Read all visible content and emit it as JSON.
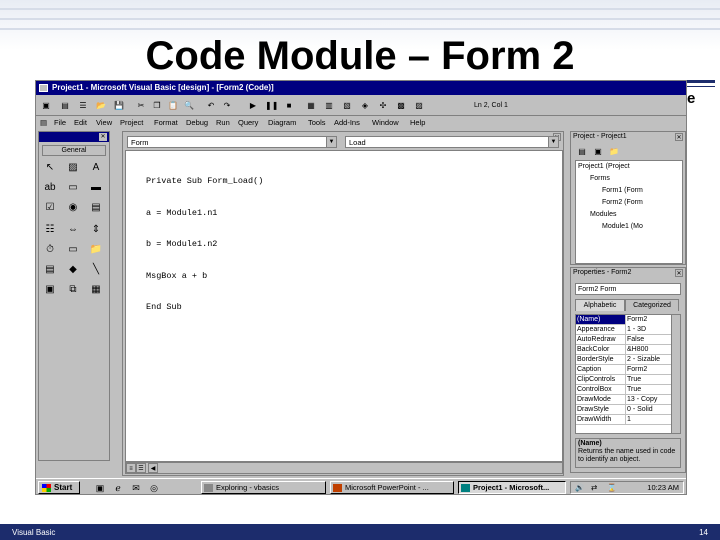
{
  "slide": {
    "title": "Code Module – Form 2",
    "cut_word": "ure",
    "footer_left": "Visual Basic",
    "page_number": "14"
  },
  "window": {
    "title": "Project1 - Microsoft Visual Basic [design] - [Form2 (Code)]",
    "toolbar_position": "Ln 2, Col 1"
  },
  "menu": [
    "File",
    "Edit",
    "View",
    "Project",
    "Format",
    "Debug",
    "Run",
    "Query",
    "Diagram",
    "Tools",
    "Add-Ins",
    "Window",
    "Help"
  ],
  "toolbox": {
    "tab_label": "General"
  },
  "code_window": {
    "object_combo": "Form",
    "procedure_combo": "Load",
    "lines": [
      "Private Sub Form_Load()",
      "a = Module1.n1",
      "b = Module1.n2",
      "MsgBox a + b",
      "End Sub"
    ]
  },
  "project_explorer": {
    "title": "Project - Project1",
    "items": [
      "Project1 (Project",
      "Forms",
      "Form1 (Form",
      "Form2 (Form",
      "Modules",
      "Module1 (Mo"
    ]
  },
  "properties": {
    "title": "Properties - Form2",
    "object_combo": "Form2 Form",
    "tabs": [
      "Alphabetic",
      "Categorized"
    ],
    "rows": [
      {
        "name": "(Name)",
        "value": "Form2"
      },
      {
        "name": "Appearance",
        "value": "1 - 3D"
      },
      {
        "name": "AutoRedraw",
        "value": "False"
      },
      {
        "name": "BackColor",
        "value": "&H800"
      },
      {
        "name": "BorderStyle",
        "value": "2 - Sizable"
      },
      {
        "name": "Caption",
        "value": "Form2"
      },
      {
        "name": "ClipControls",
        "value": "True"
      },
      {
        "name": "ControlBox",
        "value": "True"
      },
      {
        "name": "DrawMode",
        "value": "13 - Copy"
      },
      {
        "name": "DrawStyle",
        "value": "0 - Solid"
      },
      {
        "name": "DrawWidth",
        "value": "1"
      }
    ],
    "description_title": "(Name)",
    "description_text": "Returns the name used in code to identify an object."
  },
  "taskbar": {
    "start_label": "Start",
    "tasks": [
      "Exploring - vbasics",
      "Microsoft PowerPoint - ...",
      "Project1 - Microsoft..."
    ],
    "clock": "10:23 AM"
  }
}
